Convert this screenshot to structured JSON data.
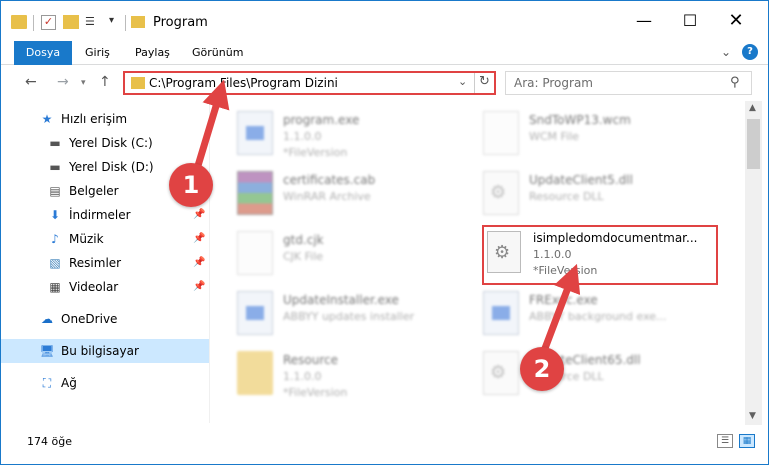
{
  "window": {
    "title": "Program",
    "minimize": "—",
    "maximize": "☐",
    "close": "✕"
  },
  "ribbon": {
    "tabs": [
      "Dosya",
      "Giriş",
      "Paylaş",
      "Görünüm"
    ],
    "help": "?"
  },
  "navigation": {
    "address": "C:\\Program Files\\Program Dizini",
    "search_placeholder": "Ara: Program"
  },
  "sidebar": {
    "items": [
      {
        "label": "Hızlı erişim",
        "icon": "star-icon"
      },
      {
        "label": "Yerel Disk (C:)",
        "icon": "drive-icon"
      },
      {
        "label": "Yerel Disk (D:)",
        "icon": "drive-icon"
      },
      {
        "label": "Belgeler",
        "icon": "document-icon"
      },
      {
        "label": "İndirmeler",
        "icon": "download-icon"
      },
      {
        "label": "Müzik",
        "icon": "music-icon"
      },
      {
        "label": "Resimler",
        "icon": "picture-icon"
      },
      {
        "label": "Videolar",
        "icon": "film-icon"
      },
      {
        "label": "OneDrive",
        "icon": "cloud-icon"
      },
      {
        "label": "Bu bilgisayar",
        "icon": "computer-icon"
      },
      {
        "label": "Ağ",
        "icon": "network-icon"
      }
    ]
  },
  "files": [
    {
      "name": "program.exe",
      "line2": "1.1.0.0",
      "line3": "*FileVersion",
      "icon": "exe-icon"
    },
    {
      "name": "SndToWP13.wcm",
      "line2": "WCM File",
      "line3": "",
      "icon": "document-icon"
    },
    {
      "name": "certificates.cab",
      "line2": "WinRAR Archive",
      "line3": "",
      "icon": "archive-icon"
    },
    {
      "name": "UpdateClient5.dll",
      "line2": "Resource DLL",
      "line3": "",
      "icon": "dll-icon"
    },
    {
      "name": "gtd.cjk",
      "line2": "CJK File",
      "line3": "",
      "icon": "document-icon"
    },
    {
      "name": "isimpledomdocumentmar...",
      "line2": "1.1.0.0",
      "line3": "*FileVersion",
      "icon": "dll-icon"
    },
    {
      "name": "UpdateInstaller.exe",
      "line2": "ABBYY updates installer",
      "line3": "",
      "icon": "exe-icon"
    },
    {
      "name": "FRExec.exe",
      "line2": "ABBYY background exe...",
      "line3": "",
      "icon": "exe-icon"
    },
    {
      "name": "Resource",
      "line2": "1.1.0.0",
      "line3": "*FileVersion",
      "icon": "folder-icon"
    },
    {
      "name": "UpdateClient65.dll",
      "line2": "Resource DLL",
      "line3": "",
      "icon": "dll-icon"
    }
  ],
  "status": {
    "item_count": "174 öğe"
  },
  "annotations": {
    "step1": "1",
    "step2": "2"
  },
  "colors": {
    "accent": "#1979ca",
    "highlight": "#e04343",
    "selected": "#cce8ff"
  }
}
